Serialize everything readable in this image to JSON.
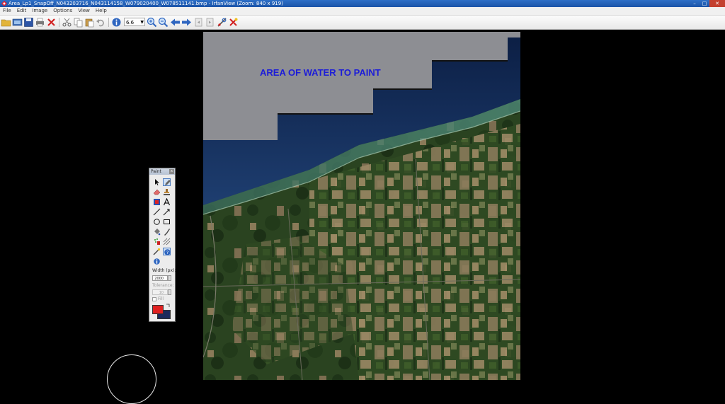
{
  "window": {
    "title": "Area_Lp1_SnapOff_N043203716_N043114158_W079020400_W078511141.bmp - IrfanView (Zoom: 840 x 919)"
  },
  "menu": [
    "File",
    "Edit",
    "Image",
    "Options",
    "View",
    "Help"
  ],
  "toolbar": {
    "zoom_value": "6.6",
    "buttons": [
      "open-folder-icon",
      "slideshow-icon",
      "save-icon",
      "print-icon",
      "delete-icon",
      "cut-icon",
      "copy-icon",
      "paste-icon",
      "undo-icon",
      "info-icon",
      "zoom-in-icon",
      "zoom-out-icon",
      "previous-icon",
      "next-icon",
      "first-page-icon",
      "last-page-icon",
      "settings-icon",
      "exit-icon"
    ]
  },
  "image": {
    "annotation": "AREA OF WATER TO PAINT"
  },
  "paint_panel": {
    "title": "Paint",
    "close": "x",
    "width_label": "Width (px):",
    "width_value": "2000",
    "tolerance_label": "Tolerance:",
    "tolerance_value": "10",
    "fill_label": "Fill",
    "foreground_color": "#e02020",
    "background_color": "#1c2a5c",
    "tools": [
      "selection-arrow-icon",
      "pencil-icon",
      "eraser-icon",
      "stamp-icon",
      "color-picker-icon",
      "text-icon",
      "line-icon",
      "arrow-line-icon",
      "ellipse-icon",
      "rectangle-icon",
      "fill-bucket-icon",
      "brush-icon",
      "spray-icon",
      "pattern-icon",
      "magic-wand-icon",
      "help-icon",
      "info-icon"
    ]
  }
}
